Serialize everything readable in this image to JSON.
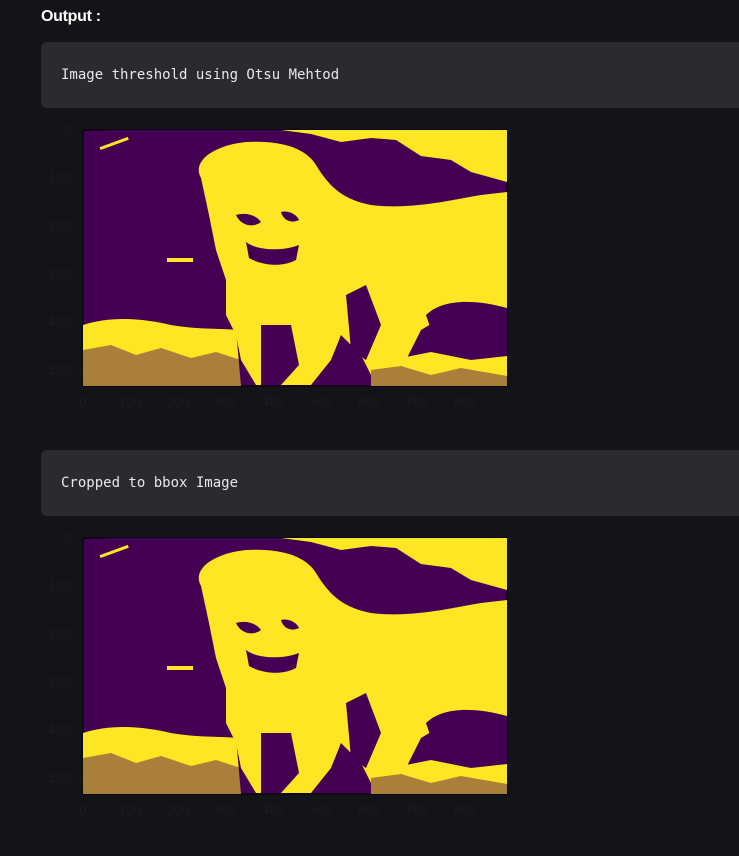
{
  "output": {
    "label": "Output :"
  },
  "outputs": [
    {
      "code_text": "Image threshold using Otsu Mehtod",
      "image": {
        "x_ticks": [
          "0",
          "100",
          "200",
          "300",
          "400",
          "500",
          "600",
          "700",
          "800"
        ],
        "y_ticks": [
          "0",
          "100",
          "200",
          "300",
          "400",
          "500"
        ],
        "colors": {
          "background": "#440154",
          "foreground": "#fde725"
        }
      }
    },
    {
      "code_text": "Cropped to bbox Image",
      "image": {
        "x_ticks": [
          "0",
          "100",
          "200",
          "300",
          "400",
          "500",
          "600",
          "700",
          "800"
        ],
        "y_ticks": [
          "0",
          "100",
          "200",
          "300",
          "400",
          "500"
        ],
        "colors": {
          "background": "#440154",
          "foreground": "#fde725"
        }
      }
    }
  ]
}
